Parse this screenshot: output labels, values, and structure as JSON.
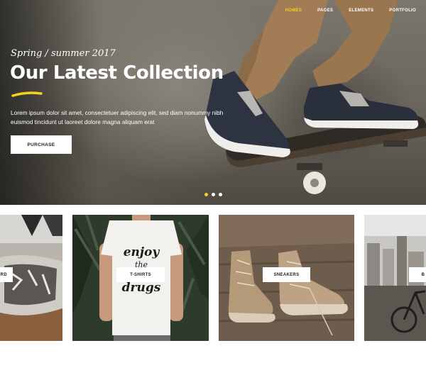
{
  "nav": {
    "items": [
      "HOMES",
      "PAGES",
      "ELEMENTS",
      "PORTFOLIO"
    ],
    "active_index": 0
  },
  "hero": {
    "subtitle": "Spring / summer 2017",
    "title": "Our Latest Collection",
    "description": "Lorem ipsum dolor sit amet, consectetuer adipiscing elit, sed diam nonummy nibh euismod tincidunt ut laoreet dolore magna aliquam erat",
    "button_label": "PURCHASE",
    "slider": {
      "count": 3,
      "active_index": 0
    }
  },
  "categories": [
    {
      "label": "ARD"
    },
    {
      "label": "T-SHIRTS",
      "shirt_print": [
        "enjoy",
        "the",
        "drugs"
      ]
    },
    {
      "label": "SNEAKERS"
    },
    {
      "label": "B"
    }
  ],
  "colors": {
    "accent": "#f2d21c",
    "white": "#ffffff",
    "text_dark": "#222222"
  }
}
